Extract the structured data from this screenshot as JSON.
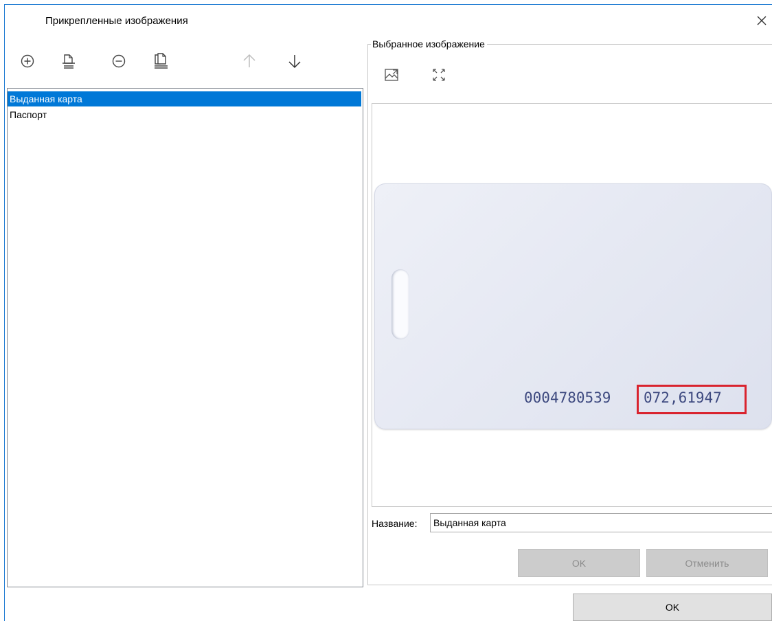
{
  "window": {
    "title": "Прикрепленные изображения"
  },
  "toolbar": {
    "icons": [
      "add-circle-icon",
      "page-add-icon",
      "remove-circle-icon",
      "page-copy-icon",
      "arrow-up-icon",
      "arrow-down-icon"
    ]
  },
  "list": {
    "items": [
      {
        "label": "Выданная карта",
        "selected": true
      },
      {
        "label": "Паспорт",
        "selected": false
      }
    ]
  },
  "preview": {
    "group_title": "Выбранное изображение",
    "icons": [
      "fit-image-icon",
      "expand-icon"
    ],
    "card": {
      "number": "0004780539",
      "code": "072,61947"
    }
  },
  "form": {
    "name_label": "Название:",
    "name_value": "Выданная карта",
    "ok_label": "OK",
    "cancel_label": "Отменить"
  },
  "footer": {
    "ok_label": "OK"
  },
  "colors": {
    "selection": "#0078d7",
    "highlight_frame": "#d9232e",
    "window_border": "#1f7bd3"
  }
}
